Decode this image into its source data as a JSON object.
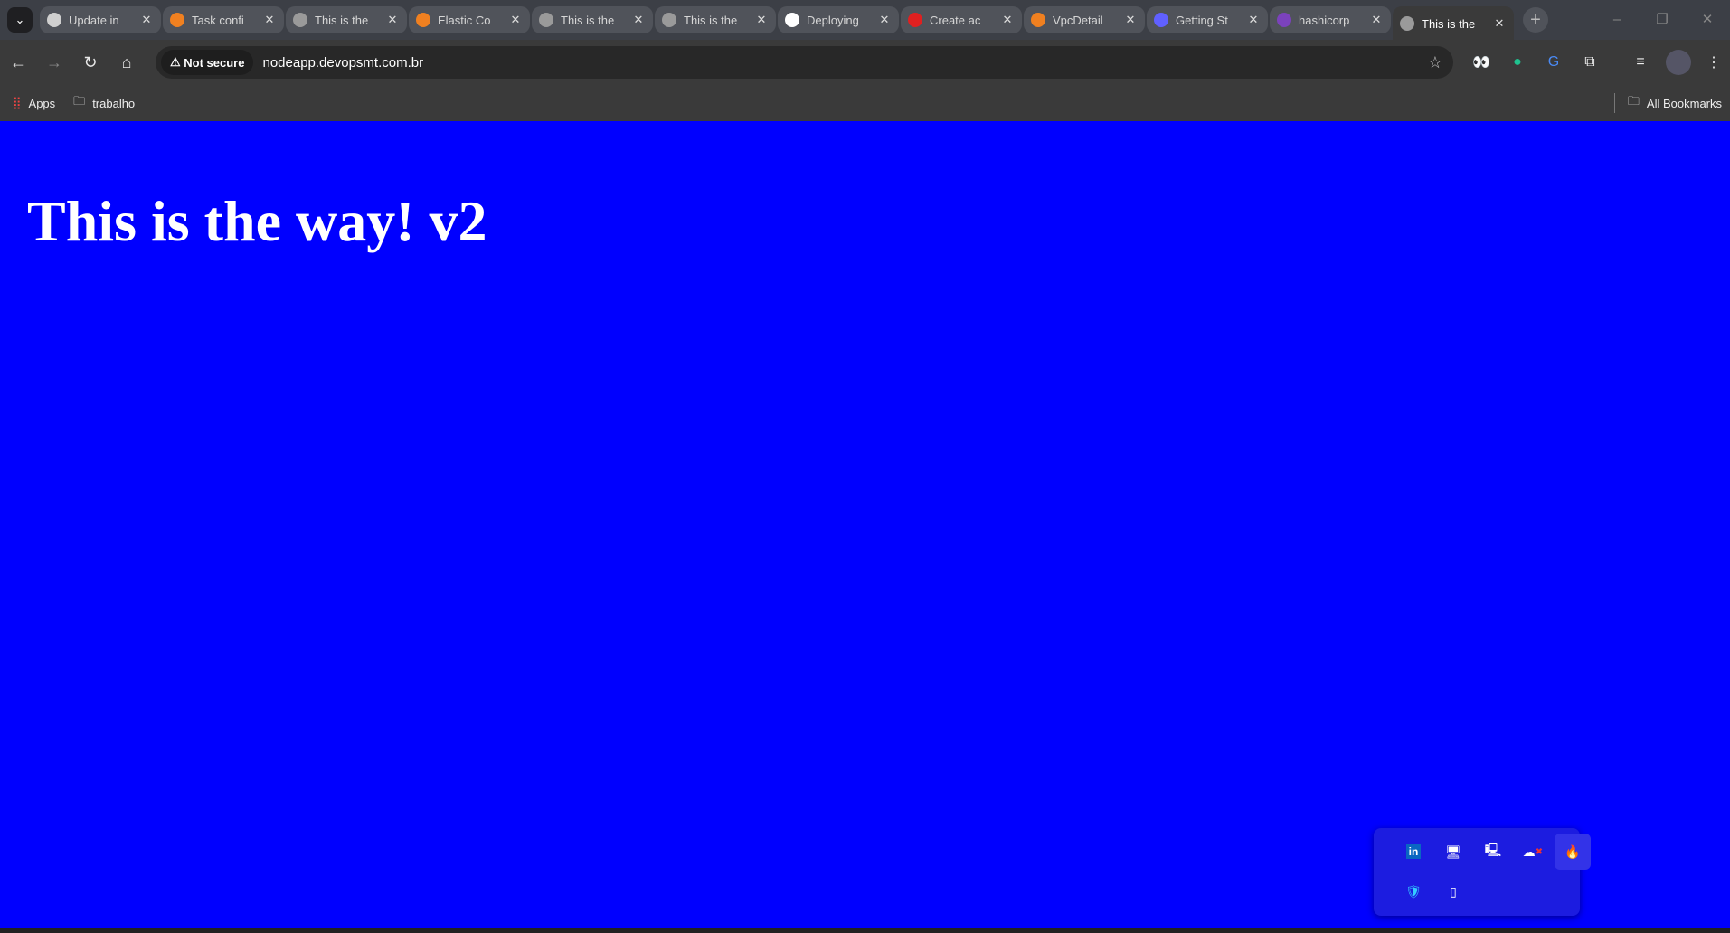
{
  "tabs": [
    {
      "title": "Update in",
      "icon": "github-actions-icon",
      "color": "#cfcfcf"
    },
    {
      "title": "Task confi",
      "icon": "grafana-icon",
      "color": "#f08020"
    },
    {
      "title": "This is the",
      "icon": "globe-icon",
      "color": "#9a9a9a"
    },
    {
      "title": "Elastic Co",
      "icon": "grafana-icon",
      "color": "#f08020"
    },
    {
      "title": "This is the",
      "icon": "globe-icon",
      "color": "#9a9a9a"
    },
    {
      "title": "This is the",
      "icon": "globe-icon",
      "color": "#9a9a9a"
    },
    {
      "title": "Deploying",
      "icon": "github-icon",
      "color": "#ffffff"
    },
    {
      "title": "Create ac",
      "icon": "create-icon",
      "color": "#e02020"
    },
    {
      "title": "VpcDetail",
      "icon": "aws-cube-icon",
      "color": "#f08020"
    },
    {
      "title": "Getting St",
      "icon": "ghost-icon",
      "color": "#6060ff"
    },
    {
      "title": "hashicorp",
      "icon": "terraform-icon",
      "color": "#7b42bc"
    },
    {
      "title": "This is the",
      "icon": "globe-icon",
      "color": "#9a9a9a",
      "active": true
    }
  ],
  "toolbar": {
    "security": "Not secure",
    "url": "nodeapp.devopsmt.com.br"
  },
  "bookmarks": {
    "apps": "Apps",
    "folder": "trabalho",
    "all": "All Bookmarks"
  },
  "page": {
    "heading": "This is the way! v2",
    "background": "#0000ff"
  },
  "tray": [
    "linkedin-icon",
    "remote-desktop-icon",
    "locked-monitor-icon",
    "cloud-error-icon",
    "flame-app-icon",
    "defender-shield-icon",
    "usb-drive-icon"
  ]
}
